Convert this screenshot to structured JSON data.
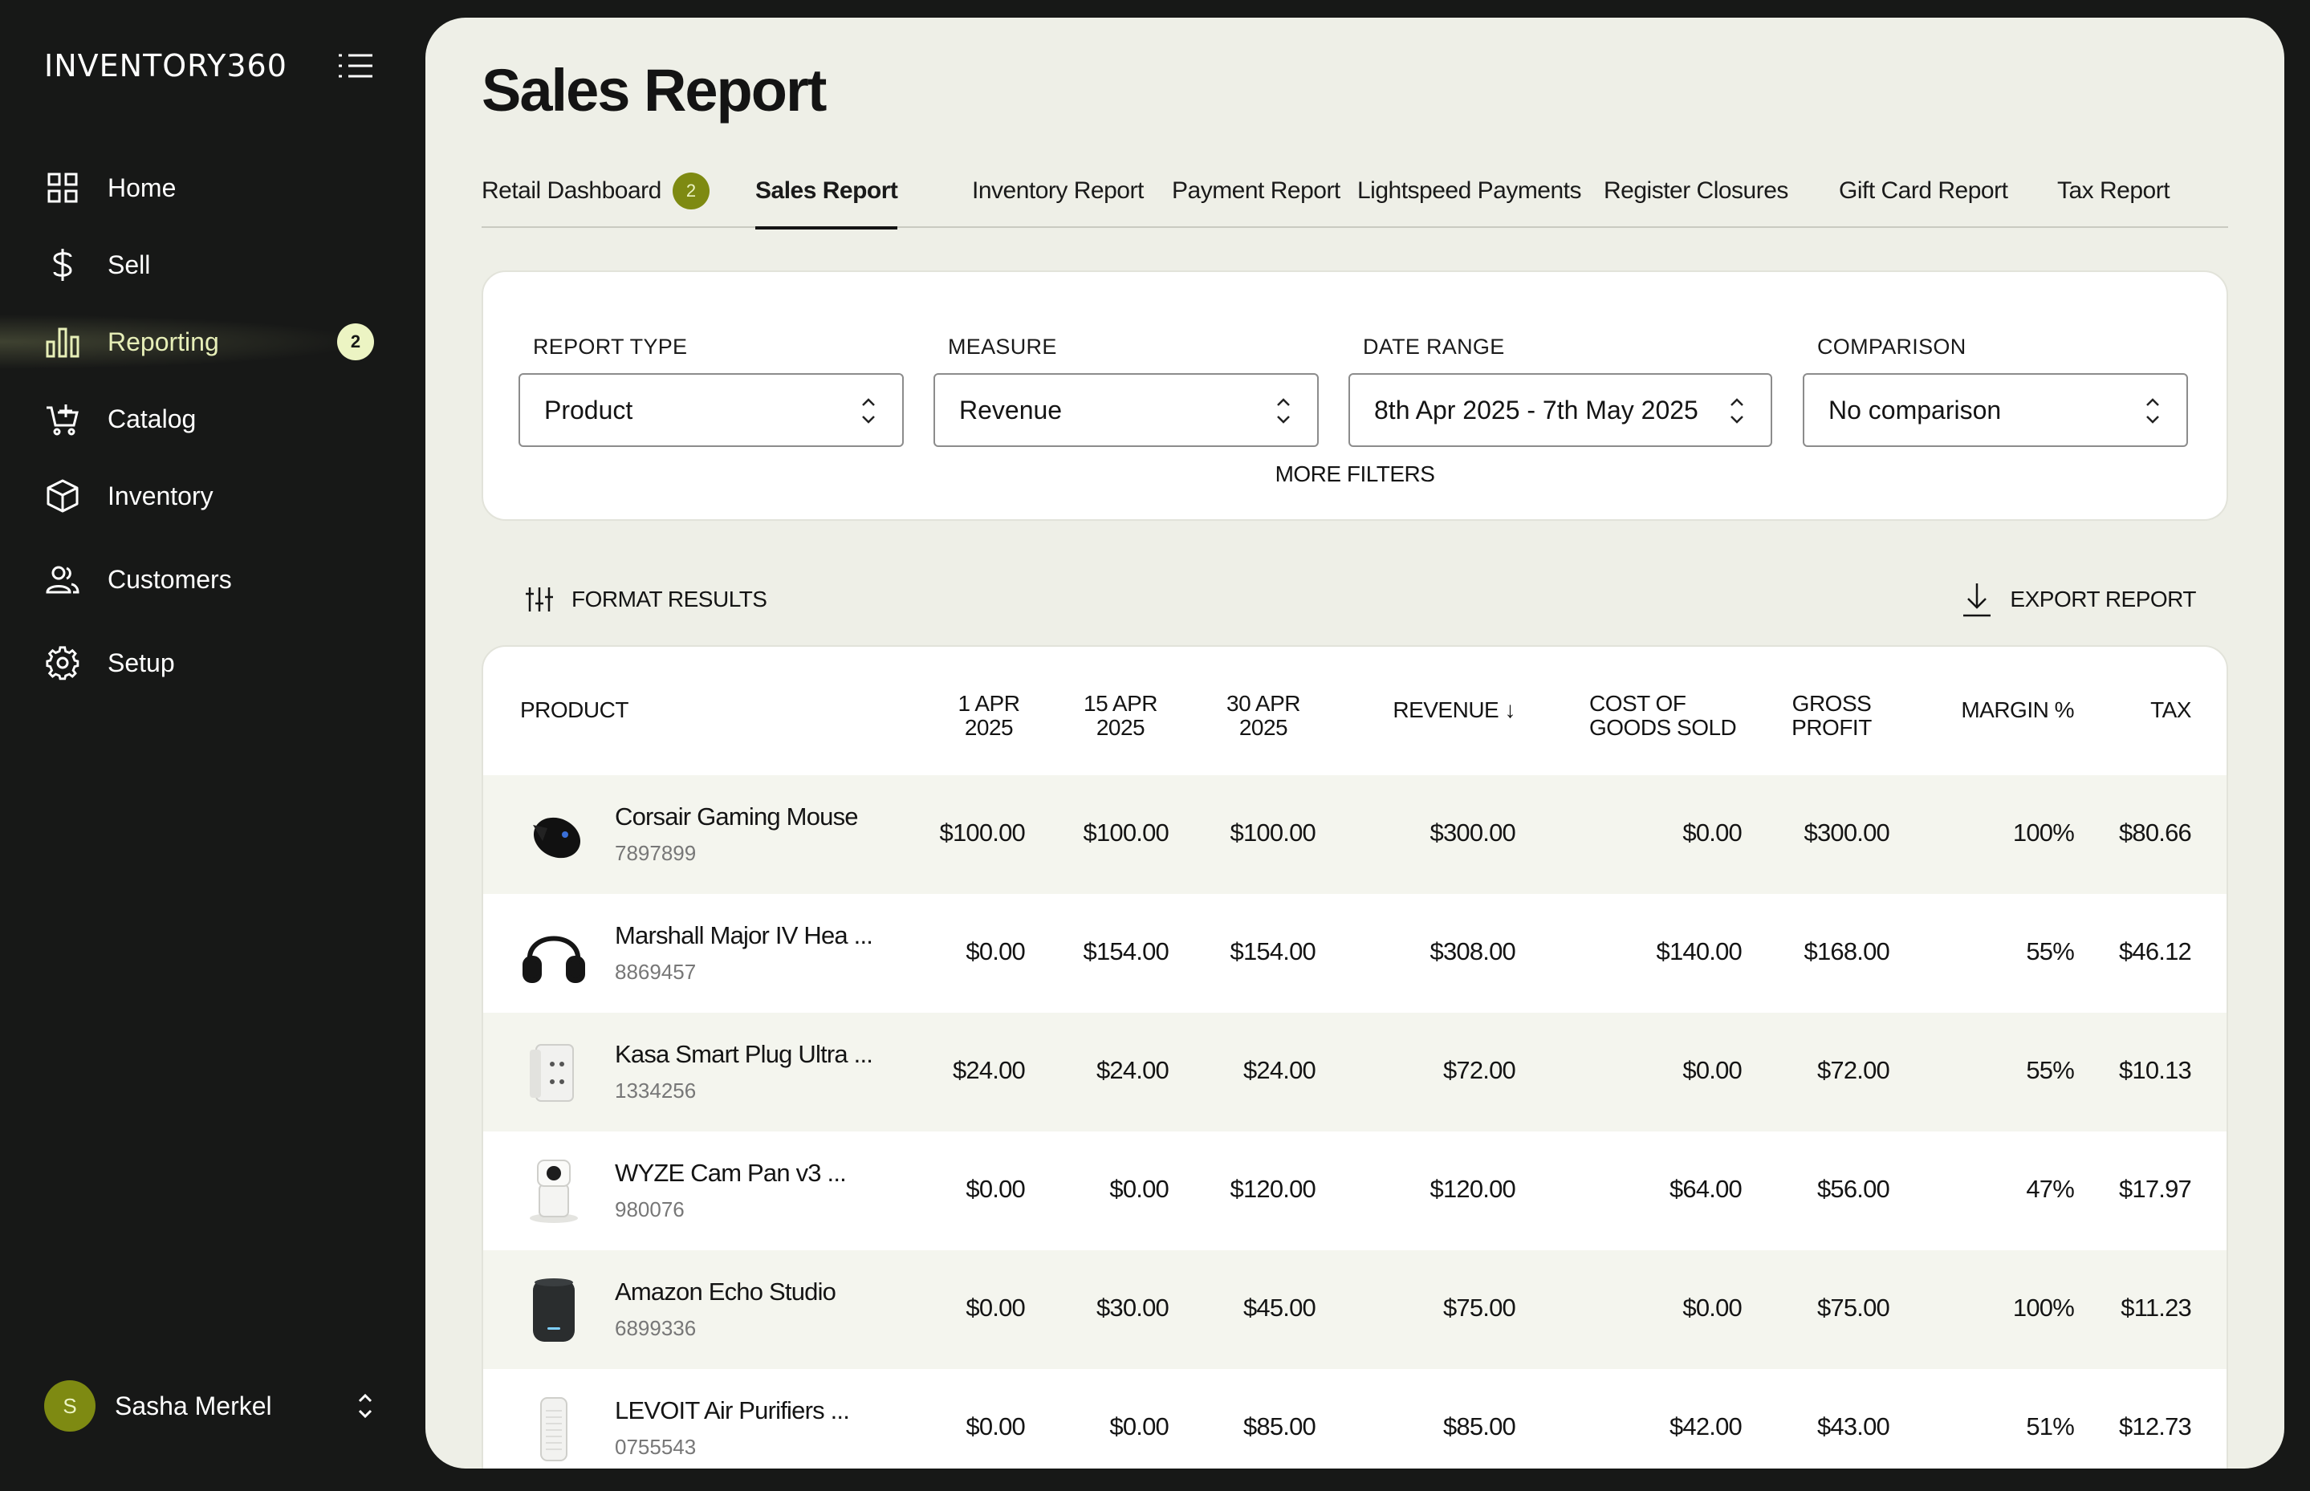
{
  "app": {
    "brand": "INVENTORY360"
  },
  "sidebar": {
    "items": [
      {
        "label": "Home",
        "icon": "grid-icon"
      },
      {
        "label": "Sell",
        "icon": "dollar-icon"
      },
      {
        "label": "Reporting",
        "icon": "bar-chart-icon",
        "active": true,
        "badge": "2"
      },
      {
        "label": "Catalog",
        "icon": "cart-icon"
      },
      {
        "label": "Inventory",
        "icon": "box-icon"
      },
      {
        "label": "Customers",
        "icon": "users-icon"
      },
      {
        "label": "Setup",
        "icon": "gear-icon"
      }
    ],
    "user": {
      "initial": "S",
      "name": "Sasha Merkel"
    }
  },
  "page": {
    "title": "Sales Report",
    "tabs": [
      {
        "label": "Retail Dashboard",
        "badge": "2"
      },
      {
        "label": "Sales Report",
        "active": true
      },
      {
        "label": "Inventory Report"
      },
      {
        "label": "Payment Report"
      },
      {
        "label": "Lightspeed Payments"
      },
      {
        "label": "Register Closures"
      },
      {
        "label": "Gift Card Report"
      },
      {
        "label": "Tax Report"
      }
    ]
  },
  "filters": {
    "report_type": {
      "label": "REPORT TYPE",
      "value": "Product"
    },
    "measure": {
      "label": "MEASURE",
      "value": "Revenue"
    },
    "date_range": {
      "label": "DATE RANGE",
      "value": "8th Apr 2025 - 7th May 2025"
    },
    "comparison": {
      "label": "COMPARISON",
      "value": "No comparison"
    },
    "more_filters": "MORE FILTERS"
  },
  "toolbar": {
    "format_results": "FORMAT RESULTS",
    "export_report": "EXPORT REPORT"
  },
  "table": {
    "headers": {
      "product": "PRODUCT",
      "d1": [
        "1 APR",
        "2025"
      ],
      "d2": [
        "15 APR",
        "2025"
      ],
      "d3": [
        "30 APR",
        "2025"
      ],
      "revenue": "REVENUE ↓",
      "cogs": [
        "COST OF",
        "GOODS SOLD"
      ],
      "gross": [
        "GROSS",
        "PROFIT"
      ],
      "margin": "MARGIN %",
      "tax": "TAX"
    },
    "rows": [
      {
        "name": "Corsair Gaming Mouse",
        "sku": "7897899",
        "thumb": "mouse",
        "d1": "$100.00",
        "d2": "$100.00",
        "d3": "$100.00",
        "revenue": "$300.00",
        "cogs": "$0.00",
        "gross": "$300.00",
        "margin": "100%",
        "tax": "$80.66"
      },
      {
        "name": "Marshall Major IV Hea ...",
        "sku": "8869457",
        "thumb": "headphones",
        "d1": "$0.00",
        "d2": "$154.00",
        "d3": "$154.00",
        "revenue": "$308.00",
        "cogs": "$140.00",
        "gross": "$168.00",
        "margin": "55%",
        "tax": "$46.12"
      },
      {
        "name": "Kasa Smart Plug Ultra ...",
        "sku": "1334256",
        "thumb": "plug",
        "d1": "$24.00",
        "d2": "$24.00",
        "d3": "$24.00",
        "revenue": "$72.00",
        "cogs": "$0.00",
        "gross": "$72.00",
        "margin": "55%",
        "tax": "$10.13"
      },
      {
        "name": "WYZE Cam Pan v3 ...",
        "sku": "980076",
        "thumb": "camera",
        "d1": "$0.00",
        "d2": "$0.00",
        "d3": "$120.00",
        "revenue": "$120.00",
        "cogs": "$64.00",
        "gross": "$56.00",
        "margin": "47%",
        "tax": "$17.97"
      },
      {
        "name": "Amazon Echo Studio",
        "sku": "6899336",
        "thumb": "speaker",
        "d1": "$0.00",
        "d2": "$30.00",
        "d3": "$45.00",
        "revenue": "$75.00",
        "cogs": "$0.00",
        "gross": "$75.00",
        "margin": "100%",
        "tax": "$11.23"
      },
      {
        "name": "LEVOIT Air Purifiers ...",
        "sku": "0755543",
        "thumb": "purifier",
        "d1": "$0.00",
        "d2": "$0.00",
        "d3": "$85.00",
        "revenue": "$85.00",
        "cogs": "$42.00",
        "gross": "$43.00",
        "margin": "51%",
        "tax": "$12.73"
      }
    ]
  },
  "colors": {
    "sidebar_bg": "#171817",
    "panel_bg": "#eeefe7",
    "accent": "#7e8a12",
    "accent_light": "#ecf4c3"
  }
}
